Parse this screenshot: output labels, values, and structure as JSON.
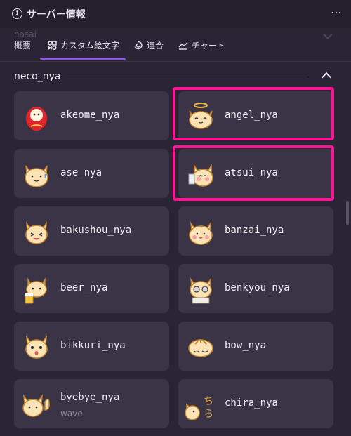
{
  "window": {
    "title": "サーバー情報",
    "more": "⋯"
  },
  "ghost": {
    "text": "nasai"
  },
  "tabs": [
    {
      "label": "概要"
    },
    {
      "label": "カスタム絵文字"
    },
    {
      "label": "連合"
    },
    {
      "label": "チャート"
    }
  ],
  "section": {
    "title": "neco_nya"
  },
  "emojis": [
    {
      "name": "akeome_nya",
      "sub": ""
    },
    {
      "name": "angel_nya",
      "sub": ""
    },
    {
      "name": "ase_nya",
      "sub": ""
    },
    {
      "name": "atsui_nya",
      "sub": ""
    },
    {
      "name": "bakushou_nya",
      "sub": ""
    },
    {
      "name": "banzai_nya",
      "sub": ""
    },
    {
      "name": "beer_nya",
      "sub": ""
    },
    {
      "name": "benkyou_nya",
      "sub": ""
    },
    {
      "name": "bikkuri_nya",
      "sub": ""
    },
    {
      "name": "bow_nya",
      "sub": ""
    },
    {
      "name": "byebye_nya",
      "sub": "wave"
    },
    {
      "name": "chira_nya",
      "sub": ""
    }
  ],
  "colors": {
    "accent": "#8e55e6",
    "highlight": "#ff1493",
    "card": "#3a3446"
  }
}
